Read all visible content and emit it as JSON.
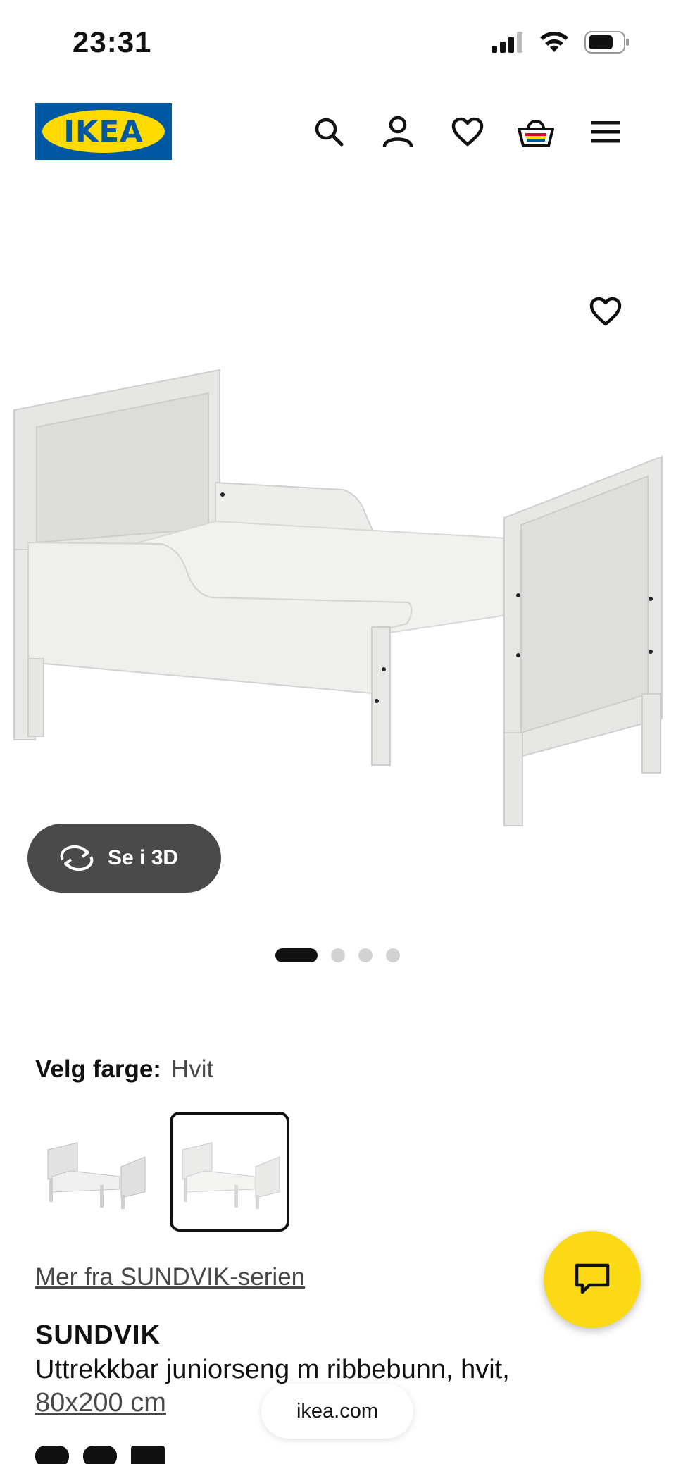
{
  "status_bar": {
    "time": "23:31"
  },
  "header": {
    "logo_text": "IKEA",
    "icons": [
      "search-icon",
      "profile-icon",
      "heart-icon",
      "basket-icon",
      "menu-icon"
    ]
  },
  "gallery": {
    "view_3d_label": "Se i 3D",
    "page_count": 4,
    "active_page": 1
  },
  "color_picker": {
    "label": "Velg farge:",
    "selected": "Hvit",
    "options_count": 2
  },
  "series_link": "Mer fra SUNDVIK-serien",
  "product": {
    "name": "SUNDVIK",
    "description": "Uttrekkbar juniorseng m ribbebunn, hvit,",
    "size": "80x200 cm"
  },
  "browser": {
    "url": "ikea.com"
  },
  "colors": {
    "ikea_blue": "#0058a3",
    "ikea_yellow": "#ffdb00",
    "chat_yellow": "#fbd914",
    "button_dark": "#4a4a4a"
  }
}
